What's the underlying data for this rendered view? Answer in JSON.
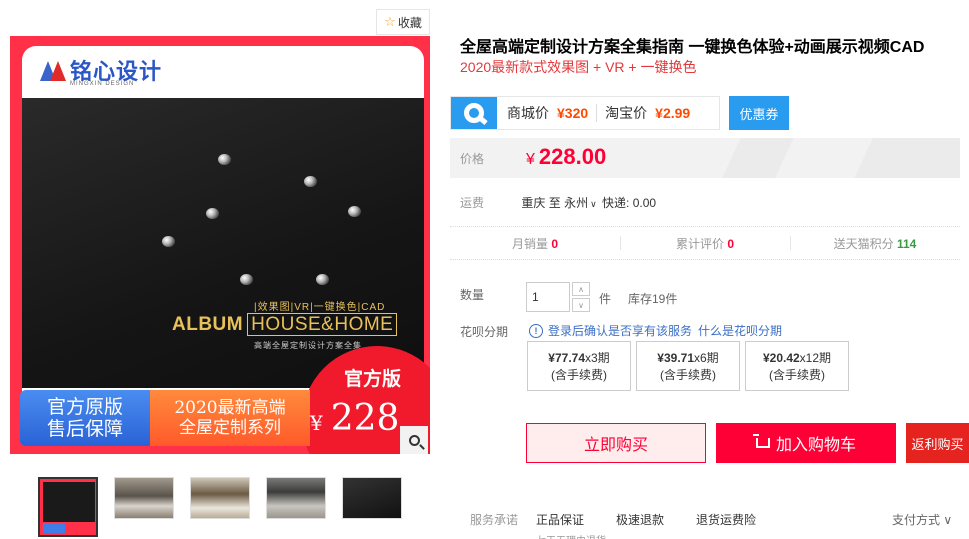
{
  "gallery": {
    "favorite_label": "收藏",
    "logo_text": "铭心设计",
    "logo_sub": "MINGXIN DESIGN",
    "album_tags": "|效果图|VR|一键换色|CAD",
    "album_title_a": "ALBUM",
    "album_title_b": "HOUSE&HOME",
    "album_sub": "高端全屋定制设计方案全集",
    "badge_official": "官方原版",
    "badge_after_sale": "售后保障",
    "promo_line1": "2020最新高端",
    "promo_line2": "全屋定制系列",
    "official_edition": "官方版",
    "promo_currency": "¥",
    "promo_price": "228",
    "thumbnail_count": 5
  },
  "product": {
    "title": "全屋高端定制设计方案全集指南 一键换色体验+动画展示视频CAD",
    "subtitle": "2020最新款式效果图 + VR + 一键换色"
  },
  "compare": {
    "mall_label": "商城价",
    "mall_price": "¥320",
    "taobao_label": "淘宝价",
    "taobao_price": "¥2.99",
    "coupon_label": "优惠券"
  },
  "price": {
    "label": "价格",
    "currency": "¥",
    "value": "228.00"
  },
  "shipping": {
    "label": "运费",
    "from": "重庆",
    "to_word": "至",
    "to_city": "永州",
    "express": "快递: 0.00"
  },
  "stats": {
    "monthly_sales_label": "月销量",
    "monthly_sales": "0",
    "reviews_label": "累计评价",
    "reviews": "0",
    "points_label": "送天猫积分",
    "points": "114"
  },
  "quantity": {
    "label": "数量",
    "value": "1",
    "unit": "件",
    "stock": "库存19件"
  },
  "huabei": {
    "label": "花呗分期",
    "note": "登录后确认是否享有该服务",
    "what_link": "什么是花呗分期",
    "plans": [
      {
        "amount": "¥77.74",
        "periods": "x3期",
        "fee": "(含手续费)"
      },
      {
        "amount": "¥39.71",
        "periods": "x6期",
        "fee": "(含手续费)"
      },
      {
        "amount": "¥20.42",
        "periods": "x12期",
        "fee": "(含手续费)"
      }
    ]
  },
  "actions": {
    "buy_now": "立即购买",
    "add_to_cart": "加入购物车",
    "rebate_buy": "返利购买"
  },
  "service": {
    "label": "服务承诺",
    "items": [
      "正品保证",
      "极速退款",
      "退货运费险"
    ],
    "payment": "支付方式",
    "cut_text": "七天无理由退货"
  },
  "colors": {
    "tmall_red": "#ff0036",
    "link_blue": "#3c6fc4",
    "accent_blue": "#2a9cf0",
    "compare_orange": "#ff4a00",
    "points_green": "#3a9b45"
  },
  "icons": [
    "star-icon",
    "zoom-icon",
    "tao-search-icon",
    "info-icon",
    "cart-icon",
    "chevron-down-icon"
  ]
}
